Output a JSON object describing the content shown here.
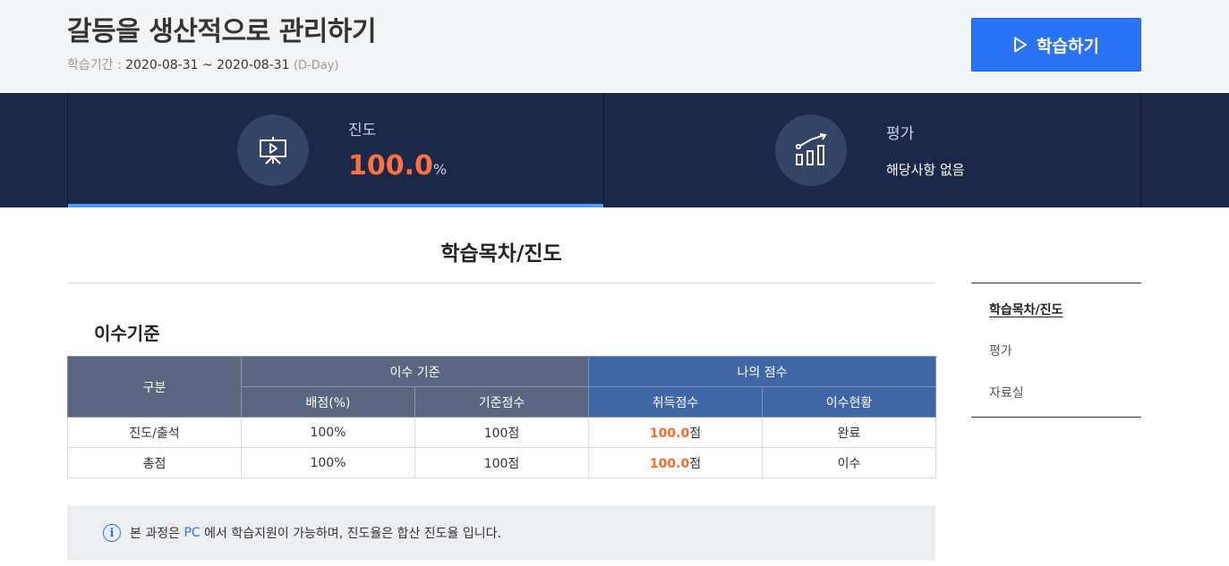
{
  "header": {
    "course_title": "갈등을 생산적으로 관리하기",
    "period_label": "학습기간 :",
    "period_range": "2020-08-31 ~ 2020-08-31",
    "period_dday": "(D-Day)",
    "start_button_label": "학습하기",
    "start_button_icon": "play-outline-icon"
  },
  "stats": {
    "progress": {
      "icon": "presentation-board-icon",
      "label": "진도",
      "value": "100.0",
      "unit": "%",
      "fraction": 1.0
    },
    "evaluation": {
      "icon": "growth-chart-icon",
      "label": "평가",
      "value": "해당사항 없음"
    }
  },
  "main": {
    "section_title": "학습목차/진도",
    "criteria_title": "이수기준",
    "table": {
      "header_category": "구분",
      "header_criteria": "이수 기준",
      "header_my_score": "나의 점수",
      "header_weight": "배점(%)",
      "header_base_score": "기준점수",
      "header_earned": "취득점수",
      "header_status": "이수현황",
      "rows": [
        {
          "category": "진도/출석",
          "weight": "100%",
          "base_score": "100점",
          "earned": "100.0",
          "earned_unit": "점",
          "status": "완료"
        },
        {
          "category": "총점",
          "weight": "100%",
          "base_score": "100점",
          "earned": "100.0",
          "earned_unit": "점",
          "status": "이수"
        }
      ]
    },
    "notice": {
      "icon": "info-circle-icon",
      "prefix": "본 과정은",
      "highlight": "PC",
      "suffix": "에서 학습지원이 가능하며, 진도율은 합산 진도율 입니다."
    }
  },
  "side_nav": {
    "items": [
      {
        "label": "학습목차/진도",
        "active": true
      },
      {
        "label": "평가",
        "active": false
      },
      {
        "label": "자료실",
        "active": false
      }
    ]
  },
  "colors": {
    "accent_blue": "#2b73f5",
    "navy_band": "#1b2848",
    "score_orange": "#ff7043",
    "table_gray": "#5a6680",
    "table_blue": "#4166a6"
  }
}
